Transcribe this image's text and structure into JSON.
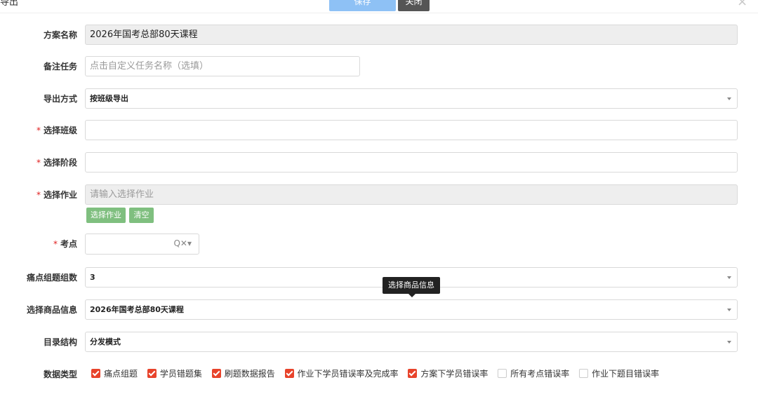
{
  "header": {
    "title": "导出",
    "save_label": "保存",
    "close_label": "关闭",
    "close_icon": "×"
  },
  "form": {
    "plan_name": {
      "label": "方案名称",
      "value": "2026年国考总部80天课程"
    },
    "remark": {
      "label": "备注任务",
      "placeholder": "点击自定义任务名称（选填）"
    },
    "export_mode": {
      "label": "导出方式",
      "value": "按班级导出"
    },
    "select_class": {
      "label": "选择班级",
      "value": ""
    },
    "select_stage": {
      "label": "选择阶段",
      "value": ""
    },
    "select_homework": {
      "label": "选择作业",
      "placeholder": "请输入选择作业",
      "choose_label": "选择作业",
      "clear_label": "清空"
    },
    "kaodian": {
      "label": "考点",
      "tools": "Q✕▾"
    },
    "pain_groups": {
      "label": "痛点组题组数",
      "value": "3"
    },
    "product_info": {
      "label": "选择商品信息",
      "value": "2026年国考总部80天课程",
      "tooltip": "选择商品信息"
    },
    "catalog": {
      "label": "目录结构",
      "value": "分发模式"
    },
    "data_types": {
      "label": "数据类型",
      "options": [
        {
          "label": "痛点组题",
          "checked": true
        },
        {
          "label": "学员错题集",
          "checked": true
        },
        {
          "label": "刷题数据报告",
          "checked": true
        },
        {
          "label": "作业下学员错误率及完成率",
          "checked": true
        },
        {
          "label": "方案下学员错误率",
          "checked": true
        },
        {
          "label": "所有考点错误率",
          "checked": false
        },
        {
          "label": "作业下题目错误率",
          "checked": false
        }
      ]
    },
    "required_mark": "*"
  }
}
